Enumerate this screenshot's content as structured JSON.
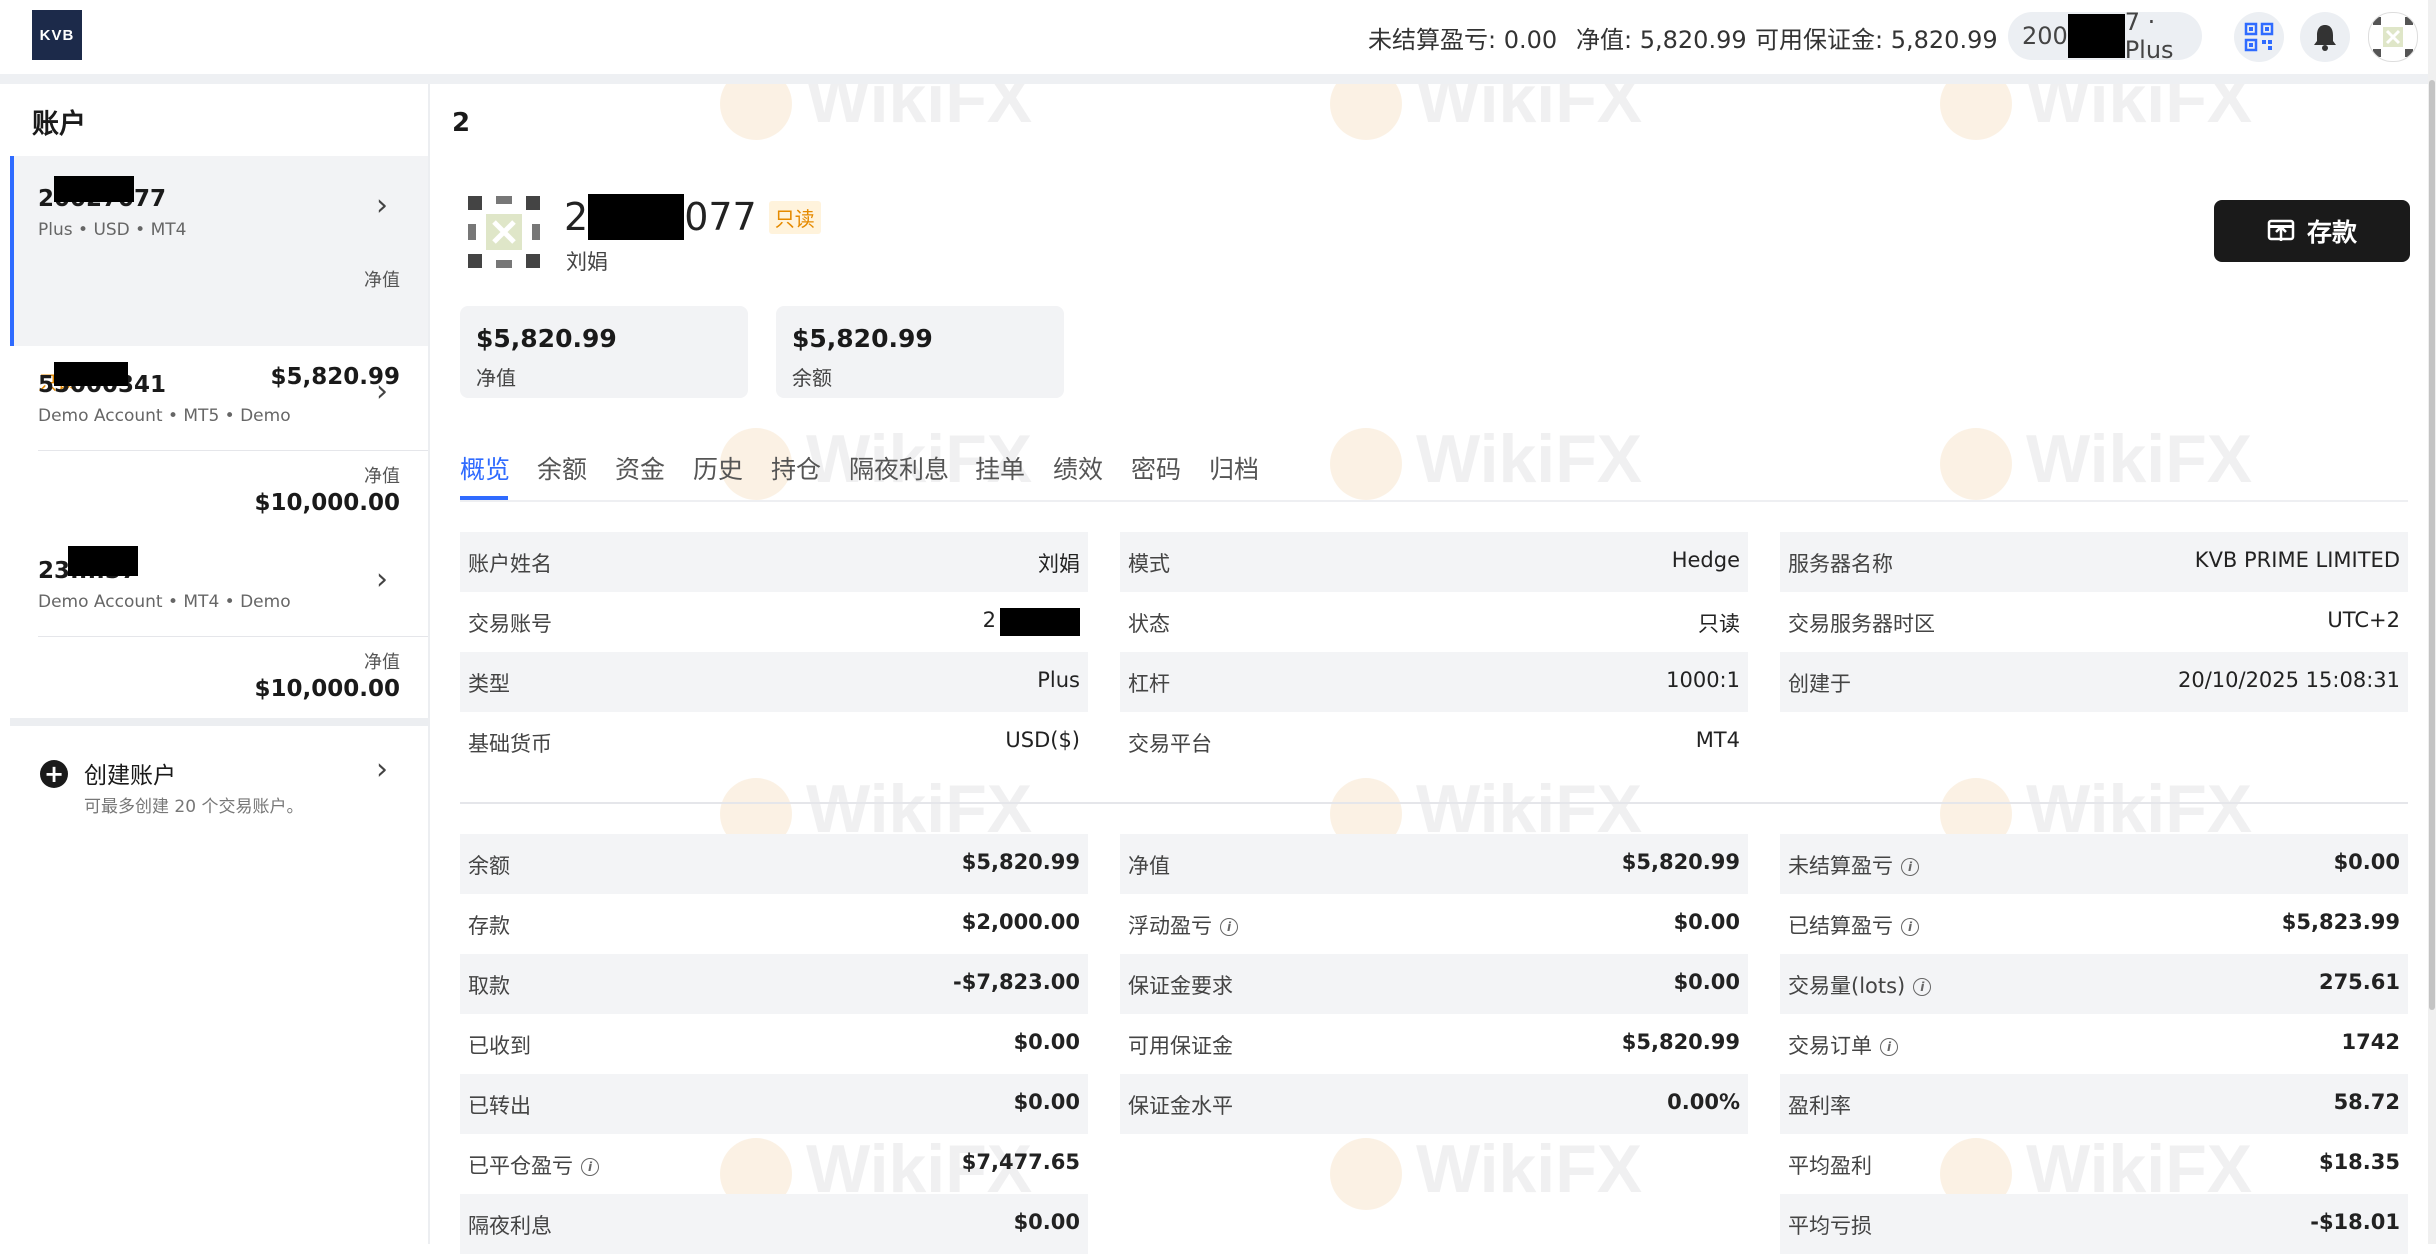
{
  "topbar": {
    "logo_text": "KVB",
    "unrealized_label": "未结算盈亏:",
    "unrealized_value": "0.00",
    "equity_label": "净值:",
    "equity_value": "5,820.99",
    "free_margin_label": "可用保证金:",
    "free_margin_value": "5,820.99",
    "account_pill_prefix": "200",
    "account_pill_suffix": "7 · Plus"
  },
  "sidebar": {
    "title": "账户",
    "accounts": [
      {
        "number": "20027077",
        "sub": "Plus • USD • MT4",
        "equity_label": "净值",
        "equity_value": "$5,820.99",
        "badge": "只读"
      },
      {
        "number": "55000341",
        "sub": "Demo Account • MT5 • Demo",
        "equity_label": "净值",
        "equity_value": "$10,000.00"
      },
      {
        "number": "23....37",
        "sub": "Demo Account • MT4 • Demo",
        "equity_label": "净值",
        "equity_value": "$10,000.00"
      }
    ],
    "create_label": "创建账户",
    "create_hint": "可最多创建 20 个交易账户。"
  },
  "main": {
    "heading": "2",
    "profile": {
      "account_prefix": "2",
      "account_suffix": "077",
      "badge": "只读",
      "name": "刘娟"
    },
    "deposit_label": "存款",
    "summary": [
      {
        "value": "$5,820.99",
        "label": "净值"
      },
      {
        "value": "$5,820.99",
        "label": "余额"
      }
    ],
    "tabs": [
      "概览",
      "余额",
      "资金",
      "历史",
      "持仓",
      "隔夜利息",
      "挂单",
      "绩效",
      "密码",
      "归档"
    ],
    "active_tab": "概览",
    "info": [
      [
        {
          "k": "账户姓名",
          "v": "刘娟"
        },
        {
          "k": "模式",
          "v": "Hedge"
        },
        {
          "k": "服务器名称",
          "v": "KVB PRIME LIMITED"
        }
      ],
      [
        {
          "k": "交易账号",
          "v": "2"
        },
        {
          "k": "状态",
          "v": "只读"
        },
        {
          "k": "交易服务器时区",
          "v": "UTC+2"
        }
      ],
      [
        {
          "k": "类型",
          "v": "Plus"
        },
        {
          "k": "杠杆",
          "v": "1000:1"
        },
        {
          "k": "创建于",
          "v": "20/10/2025 15:08:31"
        }
      ],
      [
        {
          "k": "基础货币",
          "v": "USD($)"
        },
        {
          "k": "交易平台",
          "v": "MT4"
        },
        {
          "k": "",
          "v": ""
        }
      ]
    ],
    "stats": [
      [
        {
          "k": "余额",
          "v": "$5,820.99"
        },
        {
          "k": "净值",
          "v": "$5,820.99"
        },
        {
          "k": "未结算盈亏",
          "v": "$0.00",
          "info": true
        }
      ],
      [
        {
          "k": "存款",
          "v": "$2,000.00"
        },
        {
          "k": "浮动盈亏",
          "v": "$0.00",
          "info": true
        },
        {
          "k": "已结算盈亏",
          "v": "$5,823.99",
          "info": true
        }
      ],
      [
        {
          "k": "取款",
          "v": "-$7,823.00"
        },
        {
          "k": "保证金要求",
          "v": "$0.00"
        },
        {
          "k": "交易量(lots)",
          "v": "275.61",
          "info": true
        }
      ],
      [
        {
          "k": "已收到",
          "v": "$0.00"
        },
        {
          "k": "可用保证金",
          "v": "$5,820.99"
        },
        {
          "k": "交易订单",
          "v": "1742",
          "info": true
        }
      ],
      [
        {
          "k": "已转出",
          "v": "$0.00"
        },
        {
          "k": "保证金水平",
          "v": "0.00%"
        },
        {
          "k": "盈利率",
          "v": "58.72"
        }
      ],
      [
        {
          "k": "已平仓盈亏",
          "v": "$7,477.65",
          "info": true
        },
        {
          "k": "",
          "v": ""
        },
        {
          "k": "平均盈利",
          "v": "$18.35"
        }
      ],
      [
        {
          "k": "隔夜利息",
          "v": "$0.00"
        },
        {
          "k": "",
          "v": ""
        },
        {
          "k": "平均亏损",
          "v": "-$18.01"
        }
      ]
    ]
  },
  "watermark": "WikiFX",
  "colors": {
    "accent": "#2f6bff",
    "readonly": "#e58a00",
    "dark_button": "#1a1a1a"
  }
}
